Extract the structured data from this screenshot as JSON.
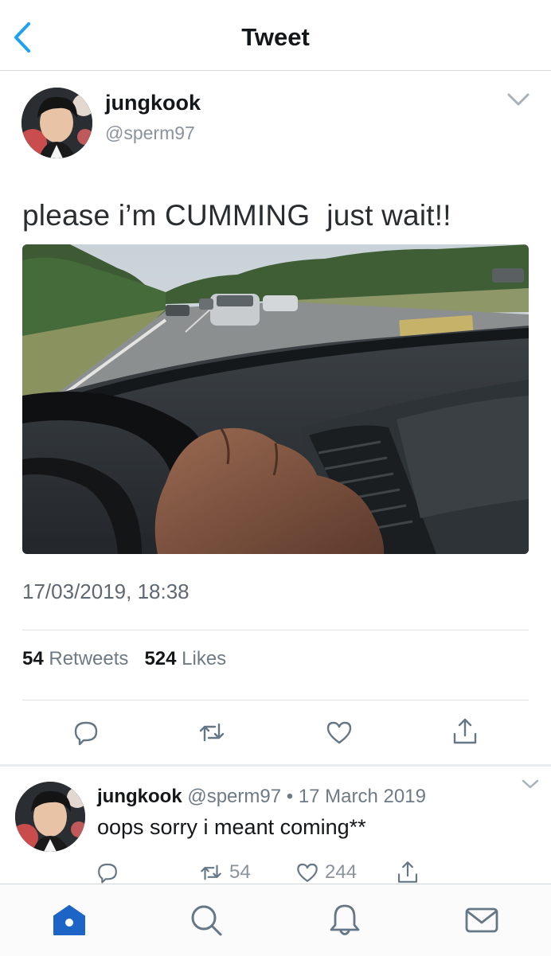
{
  "header": {
    "title": "Tweet"
  },
  "tweet": {
    "author_name": "jungkook",
    "author_handle": "@sperm97",
    "text": "please i’m CUMMING  just wait!!",
    "timestamp": "17/03/2019, 18:38",
    "retweets_count": "54",
    "retweets_label": "Retweets",
    "likes_count": "524",
    "likes_label": "Likes"
  },
  "reply": {
    "author_name": "jungkook",
    "meta": "@sperm97 • 17 March 2019",
    "text": "oops sorry i meant coming**",
    "retweets": "54",
    "likes": "244"
  },
  "tabbar": {
    "items": [
      "home-icon",
      "search-icon",
      "notifications-icon",
      "messages-icon"
    ]
  },
  "colors": {
    "accent": "#1da1f2",
    "tab_active": "#1c64c5",
    "text_secondary": "#6e7a85",
    "divider": "#dfe3e6"
  }
}
